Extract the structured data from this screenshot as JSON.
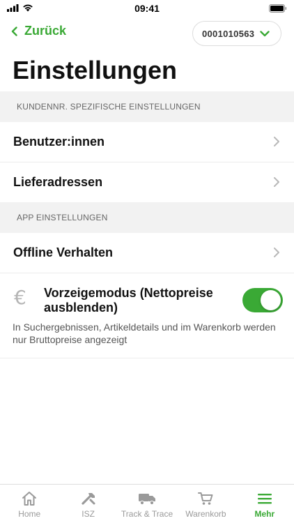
{
  "status_bar": {
    "time": "09:41"
  },
  "nav": {
    "back_label": "Zurück",
    "customer_number": "0001010563"
  },
  "page_title": "Einstellungen",
  "sections": [
    {
      "header": "KUNDENNR. SPEZIFISCHE EINSTELLUNGEN",
      "items": [
        {
          "label": "Benutzer:innen"
        },
        {
          "label": "Lieferadressen"
        }
      ]
    },
    {
      "header": "APP EINSTELLUNGEN",
      "items": [
        {
          "label": "Offline Verhalten"
        }
      ]
    }
  ],
  "demo_mode": {
    "title": "Vorzeigemodus (Nettopreise ausblenden)",
    "description": "In Suchergebnissen, Artikeldetails und im Warenkorb werden nur Bruttopreise angezeigt",
    "enabled": true,
    "icon": "euro-icon"
  },
  "tabbar": {
    "items": [
      {
        "label": "Home",
        "icon": "home-icon"
      },
      {
        "label": "ISZ",
        "icon": "tools-icon"
      },
      {
        "label": "Track & Trace",
        "icon": "truck-icon"
      },
      {
        "label": "Warenkorb",
        "icon": "cart-icon"
      },
      {
        "label": "Mehr",
        "icon": "menu-icon",
        "active": true
      }
    ]
  },
  "colors": {
    "accent": "#3aa935",
    "section_bg": "#f2f2f2",
    "inactive": "#9a9a9a"
  }
}
